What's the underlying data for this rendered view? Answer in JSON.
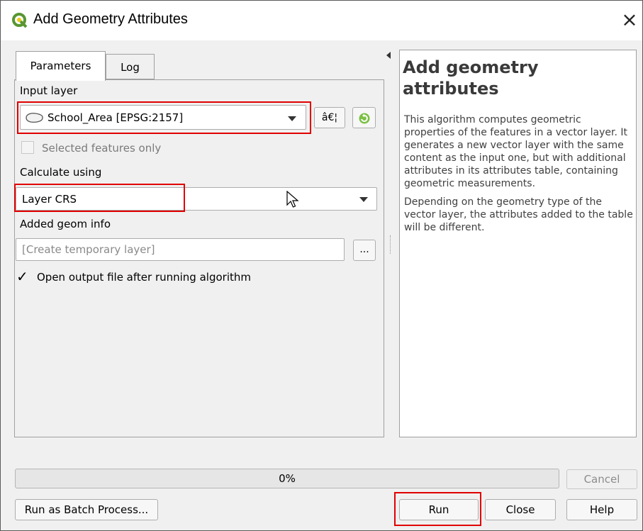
{
  "window": {
    "title": "Add Geometry Attributes",
    "close_glyph": "×",
    "app_icon": "qgis-icon"
  },
  "tabs": [
    {
      "label": "Parameters",
      "active": true
    },
    {
      "label": "Log",
      "active": false
    }
  ],
  "params": {
    "input_layer_label": "Input layer",
    "input_layer_value": "School_Area [EPSG:2157]",
    "input_layer_icon": "polygon-layer-icon",
    "browse_label": "â€¦",
    "iterate_icon": "iterate-icon",
    "selected_only_label": "Selected features only",
    "selected_only_checked": false,
    "calc_label": "Calculate using",
    "calc_value": "Layer CRS",
    "added_geom_label": "Added geom info",
    "added_geom_placeholder": "[Create temporary layer]",
    "output_browse_label": "...",
    "open_output_label": "Open output file after running algorithm",
    "open_output_checked": true,
    "check_glyph": "✓"
  },
  "help": {
    "title": "Add geometry attributes",
    "paragraph1": "This algorithm computes geometric properties of the features in a vector layer. It generates a new vector layer with the same content as the input one, but with additional attributes in its attributes table, containing geometric measurements.",
    "paragraph2": "Depending on the geometry type of the vector layer, the attributes added to the table will be different."
  },
  "progress": {
    "text": "0%",
    "value": 0
  },
  "buttons": {
    "cancel": "Cancel",
    "batch": "Run as Batch Process...",
    "run": "Run",
    "close": "Close",
    "help": "Help"
  },
  "colors": {
    "highlight_box": "#e10000",
    "qgis_green": "#589632",
    "qgis_yellow": "#eec90d"
  }
}
